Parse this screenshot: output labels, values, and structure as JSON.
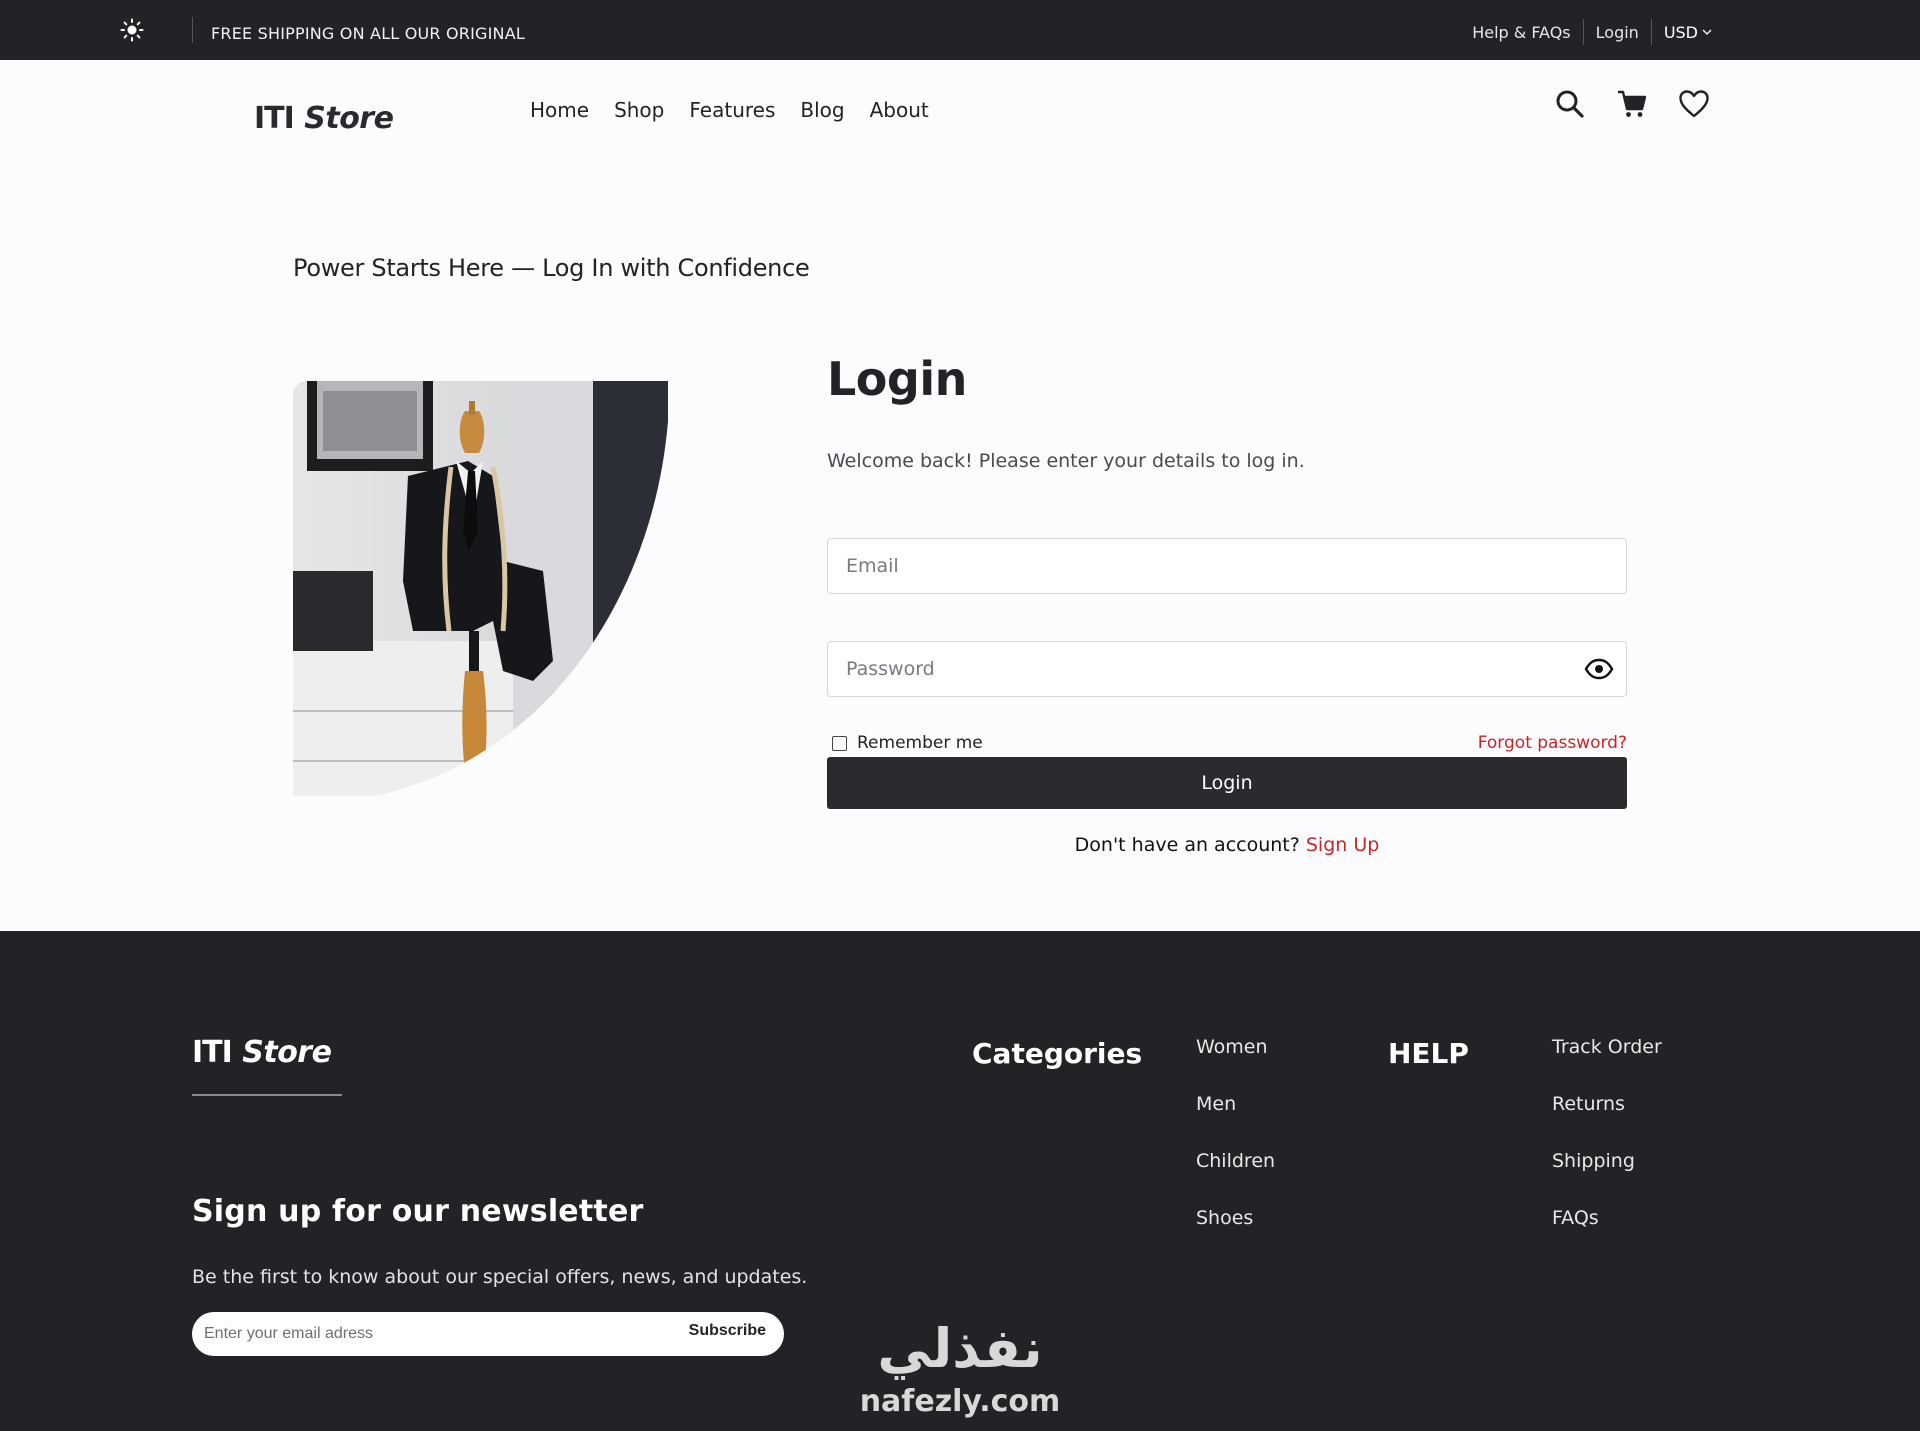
{
  "topbar": {
    "promo": "FREE SHIPPING ON ALL OUR ORIGINAL",
    "help_link": "Help & FAQs",
    "login_link": "Login",
    "currency": "USD"
  },
  "header": {
    "logo_part1": "ITI",
    "logo_part2": "Store",
    "nav": [
      "Home",
      "Shop",
      "Features",
      "Blog",
      "About"
    ],
    "icons": [
      "search-icon",
      "cart-icon",
      "heart-icon"
    ]
  },
  "main": {
    "tagline": "Power Starts Here — Log In with Confidence",
    "login_title": "Login",
    "login_subtitle": "Welcome back! Please enter your details to log in.",
    "email_placeholder": "Email",
    "email_value": "",
    "password_placeholder": "Password",
    "password_value": "",
    "remember_label": "Remember me",
    "remember_checked": false,
    "forgot_label": "Forgot password?",
    "login_button": "Login",
    "no_account_text": "Don't have an account?",
    "signup_link": "Sign Up"
  },
  "footer": {
    "logo_part1": "ITI",
    "logo_part2": "Store",
    "newsletter_title": "Sign up for our newsletter",
    "newsletter_subtitle": "Be the first to know about our special offers, news, and updates.",
    "newsletter_placeholder": "Enter your email adress",
    "subscribe_label": "Subscribe",
    "categories_title": "Categories",
    "categories": [
      "Women",
      "Men",
      "Children",
      "Shoes"
    ],
    "help_title": "HELP",
    "help_links": [
      "Track Order",
      "Returns",
      "Shipping",
      "FAQs"
    ],
    "watermark_arabic": "نفذلي",
    "watermark_latin": "nafezly.com"
  },
  "colors": {
    "dark": "#232227",
    "accent_red": "#c62828",
    "page_bg": "#fcfbfe"
  }
}
